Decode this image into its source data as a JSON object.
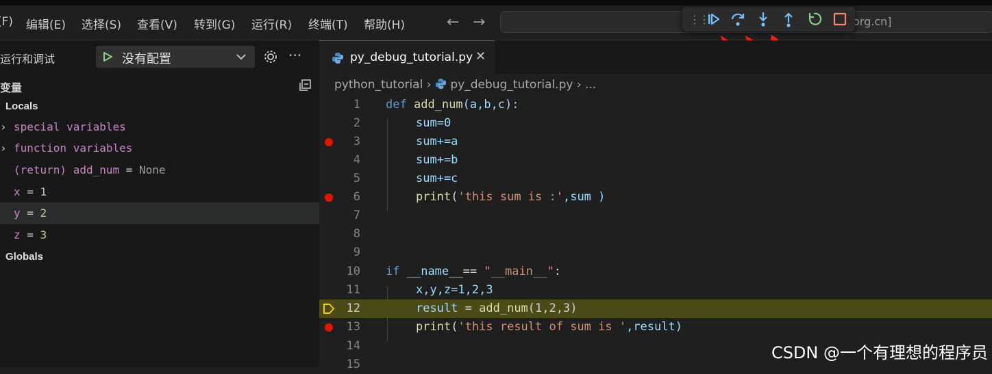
{
  "menu": {
    "items": [
      "(F)",
      "编辑(E)",
      "选择(S)",
      "查看(V)",
      "转到(G)",
      "运行(R)",
      "终端(T)",
      "帮助(H)"
    ],
    "command_center_text": "org.cn]"
  },
  "debug_toolbar": {
    "buttons": [
      "continue",
      "step-over",
      "step-into",
      "step-out",
      "restart",
      "stop"
    ]
  },
  "sidebar": {
    "title": "运行和调试",
    "config_label": "没有配置",
    "section_title": "变量",
    "locals_label": "Locals",
    "globals_label": "Globals",
    "variables": {
      "special": "special variables",
      "function": "function variables",
      "return_name": "(return) add_num",
      "return_eq": " = ",
      "return_value": "None",
      "x_name": "x",
      "x_value": "1",
      "y_name": "y",
      "y_value": "2",
      "z_name": "z",
      "z_value": "3",
      "eq": " = "
    }
  },
  "editor": {
    "tab_label": "py_debug_tutorial.py",
    "tab_close": "✕",
    "breadcrumb": {
      "folder": "python_tutorial",
      "file": "py_debug_tutorial.py",
      "rest": "...",
      "sep": "›"
    },
    "line_numbers": [
      "1",
      "2",
      "3",
      "4",
      "5",
      "6",
      "7",
      "8",
      "9",
      "10",
      "11",
      "12",
      "13",
      "14",
      "15"
    ],
    "current_line": 12,
    "breakpoint_lines": [
      3,
      6,
      13
    ],
    "tokens": {
      "def": "def",
      "fname": "add_num",
      "params": "(a,b,c):",
      "l2": "sum=0",
      "l3": "sum+=a",
      "l4": "sum+=b",
      "l5": "sum+=c",
      "print": "print",
      "l6_str": "'this sum is :'",
      "l6_rest": ",sum )",
      "l6_open": "(",
      "if": "if",
      "name": "__name__",
      "eqeq": "== ",
      "main_str": "\"__main__\"",
      "colon": ":",
      "l11": "x,y,z=1,2,3",
      "result": "result",
      "assign": " = ",
      "call": "add_num",
      "call_args": "(1,2,3)",
      "l13_str": "'this result of sum is '",
      "l13_rest": ",result)"
    }
  },
  "watermark": "CSDN @一个有理想的程序员",
  "colors": {
    "breakpoint": "#e51400",
    "current_line_bg": "#4b4b18",
    "debug_icon": "#75beff",
    "restart_icon": "#89d185",
    "stop_icon": "#f48771",
    "arrow": "#e81f1f"
  }
}
